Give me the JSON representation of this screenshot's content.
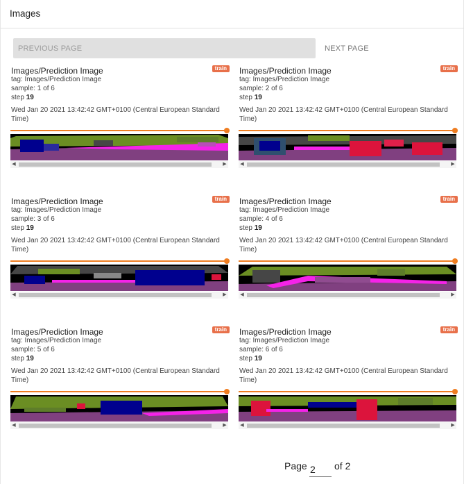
{
  "header": {
    "title": "Images"
  },
  "pagination": {
    "previous_label": "PREVIOUS PAGE",
    "next_label": "NEXT PAGE",
    "page_label": "Page",
    "current_page": "2",
    "of_label": "of 2"
  },
  "colors": {
    "badge": "#e8704a",
    "slider": "#ef7d21",
    "seg_green": "#6b8e23",
    "seg_purple": "#804080",
    "seg_magenta": "#f423e8",
    "seg_blue": "#00008e",
    "seg_red": "#dc143c",
    "seg_gray": "#464646"
  },
  "cards": [
    {
      "title": "Images/Prediction Image",
      "badge": "train",
      "tag": "tag: Images/Prediction Image",
      "sample": "sample: 1 of 6",
      "step_label": "step",
      "step": "19",
      "timestamp": "Wed Jan 20 2021 13:42:42 GMT+0100 (Central European Standard Time)"
    },
    {
      "title": "Images/Prediction Image",
      "badge": "train",
      "tag": "tag: Images/Prediction Image",
      "sample": "sample: 2 of 6",
      "step_label": "step",
      "step": "19",
      "timestamp": "Wed Jan 20 2021 13:42:42 GMT+0100 (Central European Standard Time)"
    },
    {
      "title": "Images/Prediction Image",
      "badge": "train",
      "tag": "tag: Images/Prediction Image",
      "sample": "sample: 3 of 6",
      "step_label": "step",
      "step": "19",
      "timestamp": "Wed Jan 20 2021 13:42:42 GMT+0100 (Central European Standard Time)"
    },
    {
      "title": "Images/Prediction Image",
      "badge": "train",
      "tag": "tag: Images/Prediction Image",
      "sample": "sample: 4 of 6",
      "step_label": "step",
      "step": "19",
      "timestamp": "Wed Jan 20 2021 13:42:42 GMT+0100 (Central European Standard Time)"
    },
    {
      "title": "Images/Prediction Image",
      "badge": "train",
      "tag": "tag: Images/Prediction Image",
      "sample": "sample: 5 of 6",
      "step_label": "step",
      "step": "19",
      "timestamp": "Wed Jan 20 2021 13:42:42 GMT+0100 (Central European Standard Time)"
    },
    {
      "title": "Images/Prediction Image",
      "badge": "train",
      "tag": "tag: Images/Prediction Image",
      "sample": "sample: 6 of 6",
      "step_label": "step",
      "step": "19",
      "timestamp": "Wed Jan 20 2021 13:42:42 GMT+0100 (Central European Standard Time)"
    }
  ]
}
